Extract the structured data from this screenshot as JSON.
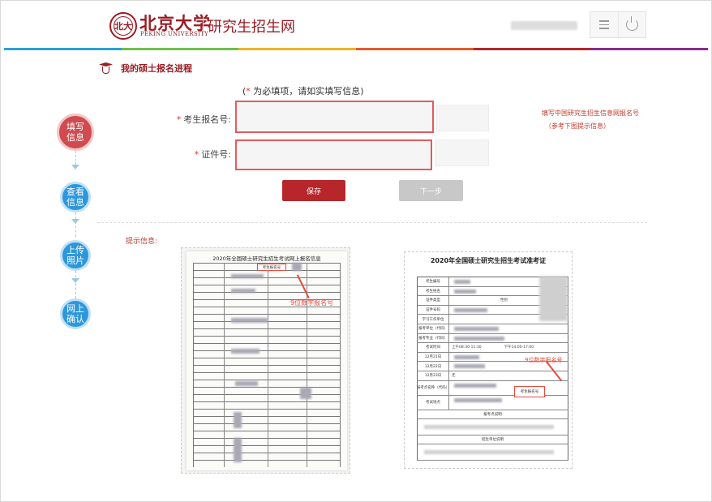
{
  "header": {
    "logo_seal_text": "北大",
    "logo_cn": "北京大学",
    "logo_en": "PEKING UNIVERSITY",
    "site_title": "研究生招生网",
    "menu_icon": "menu-icon",
    "power_icon": "power-icon"
  },
  "color_bar": [
    "#2aa0d8",
    "#6fbf4a",
    "#f0b323",
    "#e55a2b",
    "#b6262a",
    "#8a2b8d"
  ],
  "page": {
    "title": "我的硕士报名进程",
    "title_icon": "graduation-cap-icon"
  },
  "steps": [
    {
      "line1": "填写",
      "line2": "信息",
      "state": "active"
    },
    {
      "line1": "查看",
      "line2": "信息",
      "state": "todo"
    },
    {
      "line1": "上传",
      "line2": "照片",
      "state": "todo"
    },
    {
      "line1": "网上",
      "line2": "确认",
      "state": "todo"
    }
  ],
  "form": {
    "note_open": "(",
    "note_star": "*",
    "note_text": " 为必填项，请如实填写信息)",
    "fields": [
      {
        "star": "*",
        "label": "考生报名号:",
        "value": "",
        "placeholder": ""
      },
      {
        "star": "*",
        "label": "证件号:",
        "value": "",
        "placeholder": ""
      }
    ],
    "hint_line1": "填写中国研究生招生信息网报名号",
    "hint_line2": "（参考下图提示信息）",
    "save_label": "保存",
    "next_label": "下一步"
  },
  "tips": {
    "label": "提示信息:",
    "example1_title": "2020年全国硕士研究生招生考试网上报名信息",
    "example1_box": "考生报名号",
    "example1_callout": "9位数字报名号",
    "example2_title": "2020年全国硕士研究生招生考试准考证",
    "example2_callout": "9位数字报名号",
    "example2_box": "考生报名号",
    "example2_rows": [
      "考生编号",
      "考生姓名",
      "证件类型",
      "证件号码",
      "学习工作单位",
      "报考单位（代码）",
      "报考专业（代码）",
      "考试时间",
      "12月21日",
      "12月22日",
      "12月23日",
      "报考点名称（代码）",
      "考试地点"
    ],
    "example2_gender": "性别",
    "example2_am": "上午08:30-11:30",
    "example2_pm": "下午14:00-17:00",
    "example2_none": "无",
    "example2_sec1": "报考点说明",
    "example2_sec2": "招生单位说明"
  }
}
